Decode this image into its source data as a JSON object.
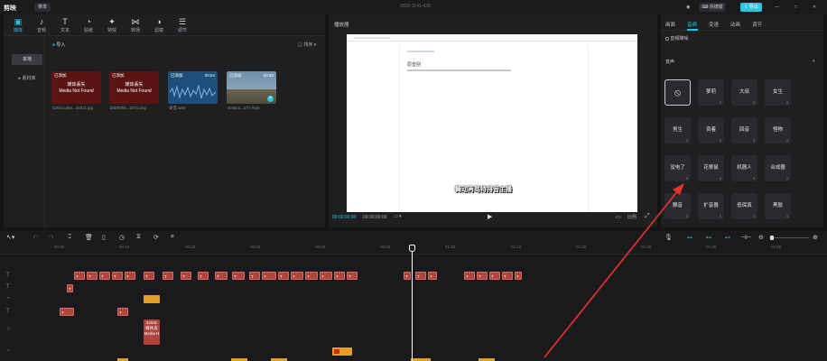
{
  "titlebar": {
    "app_name": "剪映",
    "menu_label": "菜单",
    "project_title": "0820-1141-428",
    "shortcut_label": "快捷键",
    "export_label": "导出"
  },
  "toolbar": {
    "tools": [
      {
        "label": "媒体",
        "icon": "media-icon",
        "glyph": "▣"
      },
      {
        "label": "音频",
        "icon": "audio-icon",
        "glyph": "♪"
      },
      {
        "label": "文本",
        "icon": "text-icon",
        "glyph": "T"
      },
      {
        "label": "贴纸",
        "icon": "sticker-icon",
        "glyph": "◔"
      },
      {
        "label": "特效",
        "icon": "effects-icon",
        "glyph": "✦"
      },
      {
        "label": "转场",
        "icon": "transition-icon",
        "glyph": "⋈"
      },
      {
        "label": "滤镜",
        "icon": "filter-icon",
        "glyph": "◑"
      },
      {
        "label": "调节",
        "icon": "adjust-icon",
        "glyph": "☰"
      }
    ]
  },
  "media": {
    "sidebar": {
      "local": "本地",
      "library": "素材库"
    },
    "import_label": "导入",
    "sort_label": "排序",
    "items": [
      {
        "badge": "已添加",
        "message": "媒体丢失\nMedia Not Found",
        "name": "4264cca5e...4a511.jpg"
      },
      {
        "badge": "已添加",
        "message": "媒体丢失\nMedia Not Found",
        "name": "b6b5058...1071.png"
      },
      {
        "badge": "已添加",
        "duration": "00:54",
        "name": "录音.wav"
      },
      {
        "badge": "已添加",
        "duration": "00:50",
        "name": "sevaco...271.mp4"
      }
    ]
  },
  "player": {
    "title": "播放器",
    "doc_title": "原音别",
    "subtitle": "舞动再骂特排音主播",
    "current_time": "00:00:00:00",
    "total_time": "00:00:00:00",
    "ratio_label": "比例"
  },
  "right_panel": {
    "tabs": [
      "画面",
      "音频",
      "变速",
      "动画",
      "调节"
    ],
    "active_tab": "音频",
    "audio_denoise": "音频降噪",
    "section_label": "变声",
    "voices": [
      "",
      "萝莉",
      "大叔",
      "女生",
      "男生",
      "资着",
      "回音",
      "怪物",
      "没电了",
      "花栗鼠",
      "机器人",
      "合成器",
      "颤音",
      "扩音器",
      "低保真",
      "黑胶"
    ]
  },
  "timeline": {
    "ticks": [
      "00:00",
      "00:10",
      "00:20",
      "00:30",
      "00:40",
      "00:50",
      "01:00",
      "01:10",
      "01:20",
      "01:30",
      "01:40",
      "01:50"
    ],
    "clip_label": "4264c",
    "clip_message": "媒体丢\nMedia N"
  },
  "colors": {
    "accent": "#27c8dd",
    "clip_text": "#b0433e",
    "clip_audio": "#e0a02a",
    "arrow": "#e8332a"
  }
}
